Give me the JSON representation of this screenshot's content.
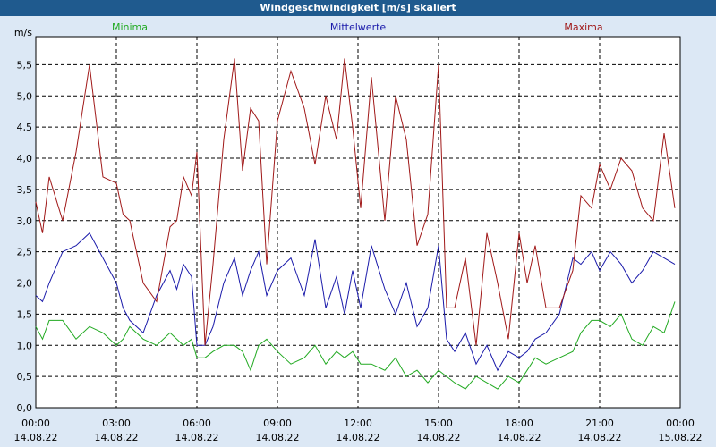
{
  "window": {
    "title": "Windgeschwindigkeit [m/s] skaliert"
  },
  "legend": {
    "min_label": "Minima",
    "mean_label": "Mittelwerte",
    "max_label": "Maxima"
  },
  "colors": {
    "min": "#22aa22",
    "mean": "#1a1aaa",
    "max": "#a01818",
    "grid": "#000000",
    "plot_bg": "#ffffff"
  },
  "chart_data": {
    "type": "line",
    "title": "Windgeschwindigkeit [m/s] skaliert",
    "ylabel": "m/s",
    "ylim": [
      0,
      6
    ],
    "xlim": [
      0,
      24
    ],
    "grid": true,
    "legend_placement": "top",
    "y_ticks": [
      "0,0",
      "0,5",
      "1,0",
      "1,5",
      "2,0",
      "2,5",
      "3,0",
      "3,5",
      "4,0",
      "4,5",
      "5,0",
      "5,5"
    ],
    "x_ticks": [
      {
        "time": "00:00",
        "date": "14.08.22"
      },
      {
        "time": "03:00",
        "date": "14.08.22"
      },
      {
        "time": "06:00",
        "date": "14.08.22"
      },
      {
        "time": "09:00",
        "date": "14.08.22"
      },
      {
        "time": "12:00",
        "date": "14.08.22"
      },
      {
        "time": "15:00",
        "date": "14.08.22"
      },
      {
        "time": "18:00",
        "date": "14.08.22"
      },
      {
        "time": "21:00",
        "date": "14.08.22"
      },
      {
        "time": "00:00",
        "date": "15.08.22"
      }
    ],
    "x_hours": [
      0,
      0.25,
      0.5,
      1,
      1.5,
      2,
      2.5,
      3,
      3.25,
      3.5,
      4,
      4.5,
      5,
      5.25,
      5.5,
      5.8,
      6.0,
      6.3,
      6.6,
      7,
      7.4,
      7.7,
      8,
      8.3,
      8.6,
      9,
      9.5,
      10,
      10.4,
      10.8,
      11.2,
      11.5,
      11.8,
      12.1,
      12.5,
      13,
      13.4,
      13.8,
      14.2,
      14.6,
      15,
      15.3,
      15.6,
      16,
      16.4,
      16.8,
      17.2,
      17.6,
      18,
      18.3,
      18.6,
      19,
      19.5,
      20,
      20.3,
      20.7,
      21,
      21.4,
      21.8,
      22.2,
      22.6,
      23,
      23.4,
      23.8
    ],
    "series": [
      {
        "name": "Minima",
        "values": [
          1.3,
          1.1,
          1.4,
          1.4,
          1.1,
          1.3,
          1.2,
          1.0,
          1.1,
          1.3,
          1.1,
          1.0,
          1.2,
          1.1,
          1.0,
          1.1,
          0.8,
          0.8,
          0.9,
          1.0,
          1.0,
          0.9,
          0.6,
          1.0,
          1.1,
          0.9,
          0.7,
          0.8,
          1.0,
          0.7,
          0.9,
          0.8,
          0.9,
          0.7,
          0.7,
          0.6,
          0.8,
          0.5,
          0.6,
          0.4,
          0.6,
          0.5,
          0.4,
          0.3,
          0.5,
          0.4,
          0.3,
          0.5,
          0.4,
          0.6,
          0.8,
          0.7,
          0.8,
          0.9,
          1.2,
          1.4,
          1.4,
          1.3,
          1.5,
          1.1,
          1.0,
          1.3,
          1.2,
          1.7
        ]
      },
      {
        "name": "Mittelwerte",
        "values": [
          1.8,
          1.7,
          2.0,
          2.5,
          2.6,
          2.8,
          2.4,
          2.0,
          1.6,
          1.4,
          1.2,
          1.8,
          2.2,
          1.9,
          2.3,
          2.1,
          1.0,
          1.0,
          1.3,
          2.0,
          2.4,
          1.8,
          2.2,
          2.5,
          1.8,
          2.2,
          2.4,
          1.8,
          2.7,
          1.6,
          2.1,
          1.5,
          2.2,
          1.6,
          2.6,
          1.9,
          1.5,
          2.0,
          1.3,
          1.6,
          2.6,
          1.1,
          0.9,
          1.2,
          0.7,
          1.0,
          0.6,
          0.9,
          0.8,
          0.9,
          1.1,
          1.2,
          1.5,
          2.4,
          2.3,
          2.5,
          2.2,
          2.5,
          2.3,
          2.0,
          2.2,
          2.5,
          2.4,
          2.3
        ]
      },
      {
        "name": "Maxima",
        "values": [
          3.3,
          2.8,
          3.7,
          3.0,
          4.1,
          5.5,
          3.7,
          3.6,
          3.1,
          3.0,
          2.0,
          1.7,
          2.9,
          3.0,
          3.7,
          3.4,
          4.1,
          1.0,
          2.3,
          4.3,
          5.6,
          3.8,
          4.8,
          4.6,
          2.3,
          4.6,
          5.4,
          4.8,
          3.9,
          5.0,
          4.3,
          5.6,
          4.5,
          3.2,
          5.3,
          3.0,
          5.0,
          4.3,
          2.6,
          3.1,
          5.5,
          1.6,
          1.6,
          2.4,
          1.0,
          2.8,
          2.0,
          1.1,
          2.8,
          2.0,
          2.6,
          1.6,
          1.6,
          2.2,
          3.4,
          3.2,
          3.9,
          3.5,
          4.0,
          3.8,
          3.2,
          3.0,
          4.4,
          3.2
        ]
      }
    ]
  }
}
